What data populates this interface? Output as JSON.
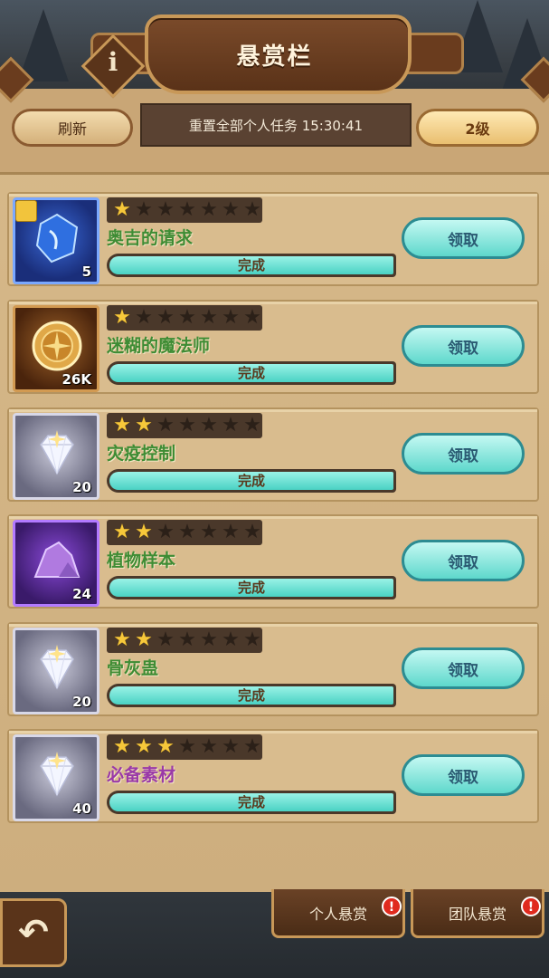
{
  "header": {
    "title": "悬赏栏",
    "info_glyph": "i"
  },
  "toolbar": {
    "refresh_label": "刷新",
    "reset_text": "重置全部个人任务 15:30:41",
    "level_label": "2级"
  },
  "quests": [
    {
      "name": "奥吉的请求",
      "stars": 1,
      "max_stars": 7,
      "item_count": "5",
      "item_type": "blue-crystal-shard",
      "progress_label": "完成",
      "progress": 1.0,
      "claim_label": "领取",
      "name_color": "green"
    },
    {
      "name": "迷糊的魔法师",
      "stars": 1,
      "max_stars": 7,
      "item_count": "26K",
      "item_type": "gold-coin",
      "progress_label": "完成",
      "progress": 1.0,
      "claim_label": "领取",
      "name_color": "green"
    },
    {
      "name": "灾疫控制",
      "stars": 2,
      "max_stars": 7,
      "item_count": "20",
      "item_type": "diamond",
      "progress_label": "完成",
      "progress": 1.0,
      "claim_label": "领取",
      "name_color": "green"
    },
    {
      "name": "植物样本",
      "stars": 2,
      "max_stars": 7,
      "item_count": "24",
      "item_type": "purple-stone",
      "progress_label": "完成",
      "progress": 1.0,
      "claim_label": "领取",
      "name_color": "green"
    },
    {
      "name": "骨灰蛊",
      "stars": 2,
      "max_stars": 7,
      "item_count": "20",
      "item_type": "diamond",
      "progress_label": "完成",
      "progress": 1.0,
      "claim_label": "领取",
      "name_color": "green"
    },
    {
      "name": "必备素材",
      "stars": 3,
      "max_stars": 7,
      "item_count": "40",
      "item_type": "diamond",
      "progress_label": "完成",
      "progress": 1.0,
      "claim_label": "领取",
      "name_color": "purple"
    }
  ],
  "bottom_tabs": [
    {
      "label": "个人悬赏",
      "alert": "!"
    },
    {
      "label": "团队悬赏",
      "alert": "!"
    }
  ],
  "back_icon": "back-arrow-icon",
  "colors": {
    "claim_button": "#5ed8cc",
    "progress_fill": "#4ad2c4",
    "star_on": "#f7c83a",
    "alert": "#e02a1e"
  }
}
